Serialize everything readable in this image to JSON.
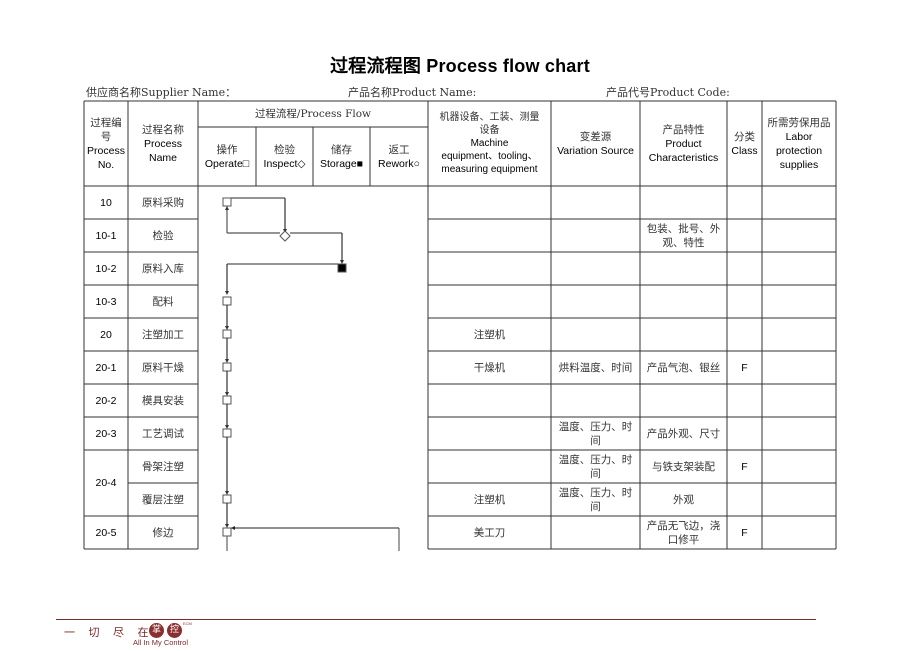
{
  "document": {
    "title": "过程流程图 Process flow chart",
    "supplier_label": "供应商名称Supplier Name：",
    "product_name_label": "产品名称Product Name:",
    "product_code_label": "产品代号Product Code:"
  },
  "table": {
    "headers": {
      "process_no": [
        "过程编",
        "号",
        "Process",
        "No."
      ],
      "process_name": [
        "过程名称",
        "Process",
        "Name"
      ],
      "process_flow": "过程流程/Process Flow",
      "flow_sub": [
        {
          "cn": "操作",
          "en": "Operate□",
          "symbol": "operate-square"
        },
        {
          "cn": "检验",
          "en": "Inspect◇",
          "symbol": "inspect-diamond"
        },
        {
          "cn": "储存",
          "en": "Storage■",
          "symbol": "storage-filled-square"
        },
        {
          "cn": "返工",
          "en": "Rework○",
          "symbol": "rework-circle"
        }
      ],
      "machine": [
        "机器设备、工装、测量",
        "设备",
        "Machine",
        "equipment、tooling、",
        "measuring equipment"
      ],
      "variation": [
        "变差源",
        "Variation Source"
      ],
      "product_char": [
        "产品特性",
        "Product",
        "Characteristics"
      ],
      "class": [
        "分类",
        "Class"
      ],
      "labor": [
        "所需劳保用品",
        "Labor",
        "protection",
        "supplies"
      ]
    },
    "rows": [
      {
        "no": "10",
        "name": "原料采购",
        "flow": "operate",
        "machine": "",
        "variation": "",
        "product": "",
        "class": "",
        "labor": ""
      },
      {
        "no": "10-1",
        "name": "检验",
        "flow": "inspect",
        "machine": "",
        "variation": "",
        "product": "包装、批号、外观、特性",
        "class": "",
        "labor": ""
      },
      {
        "no": "10-2",
        "name": "原料入库",
        "flow": "storage",
        "machine": "",
        "variation": "",
        "product": "",
        "class": "",
        "labor": ""
      },
      {
        "no": "10-3",
        "name": "配料",
        "flow": "operate",
        "machine": "",
        "variation": "",
        "product": "",
        "class": "",
        "labor": ""
      },
      {
        "no": "20",
        "name": "注塑加工",
        "flow": "operate",
        "machine": "注塑机",
        "variation": "",
        "product": "",
        "class": "",
        "labor": ""
      },
      {
        "no": "20-1",
        "name": "原料干燥",
        "flow": "operate",
        "machine": "干燥机",
        "variation": "烘料温度、时间",
        "product": "产品气泡、银丝",
        "class": "F",
        "labor": ""
      },
      {
        "no": "20-2",
        "name": "模具安装",
        "flow": "operate",
        "machine": "",
        "variation": "",
        "product": "",
        "class": "",
        "labor": ""
      },
      {
        "no": "20-3",
        "name": "工艺调试",
        "flow": "operate",
        "machine": "",
        "variation": "温度、压力、时间",
        "product": "产品外观、尺寸",
        "class": "",
        "labor": ""
      },
      {
        "no": "20-4",
        "name": "骨架注塑",
        "flow": "none",
        "machine": "",
        "variation": "温度、压力、时间",
        "product": "与铁支架装配",
        "class": "F",
        "labor": ""
      },
      {
        "no": "",
        "name": "覆层注塑",
        "flow": "operate",
        "machine": "注塑机",
        "variation": "温度、压力、时间",
        "product": "外观",
        "class": "",
        "labor": ""
      },
      {
        "no": "20-5",
        "name": "修边",
        "flow": "operate",
        "machine": "美工刀",
        "variation": "",
        "product": "产品无飞边，浇口修平",
        "class": "F",
        "labor": ""
      }
    ]
  },
  "footer": {
    "slogan": "一 切 尽 在",
    "logo_chars": [
      "掌",
      "控"
    ],
    "logo_sup": "ECM",
    "tagline": "All In My Control",
    "accent_color": "#7a2a2a"
  }
}
